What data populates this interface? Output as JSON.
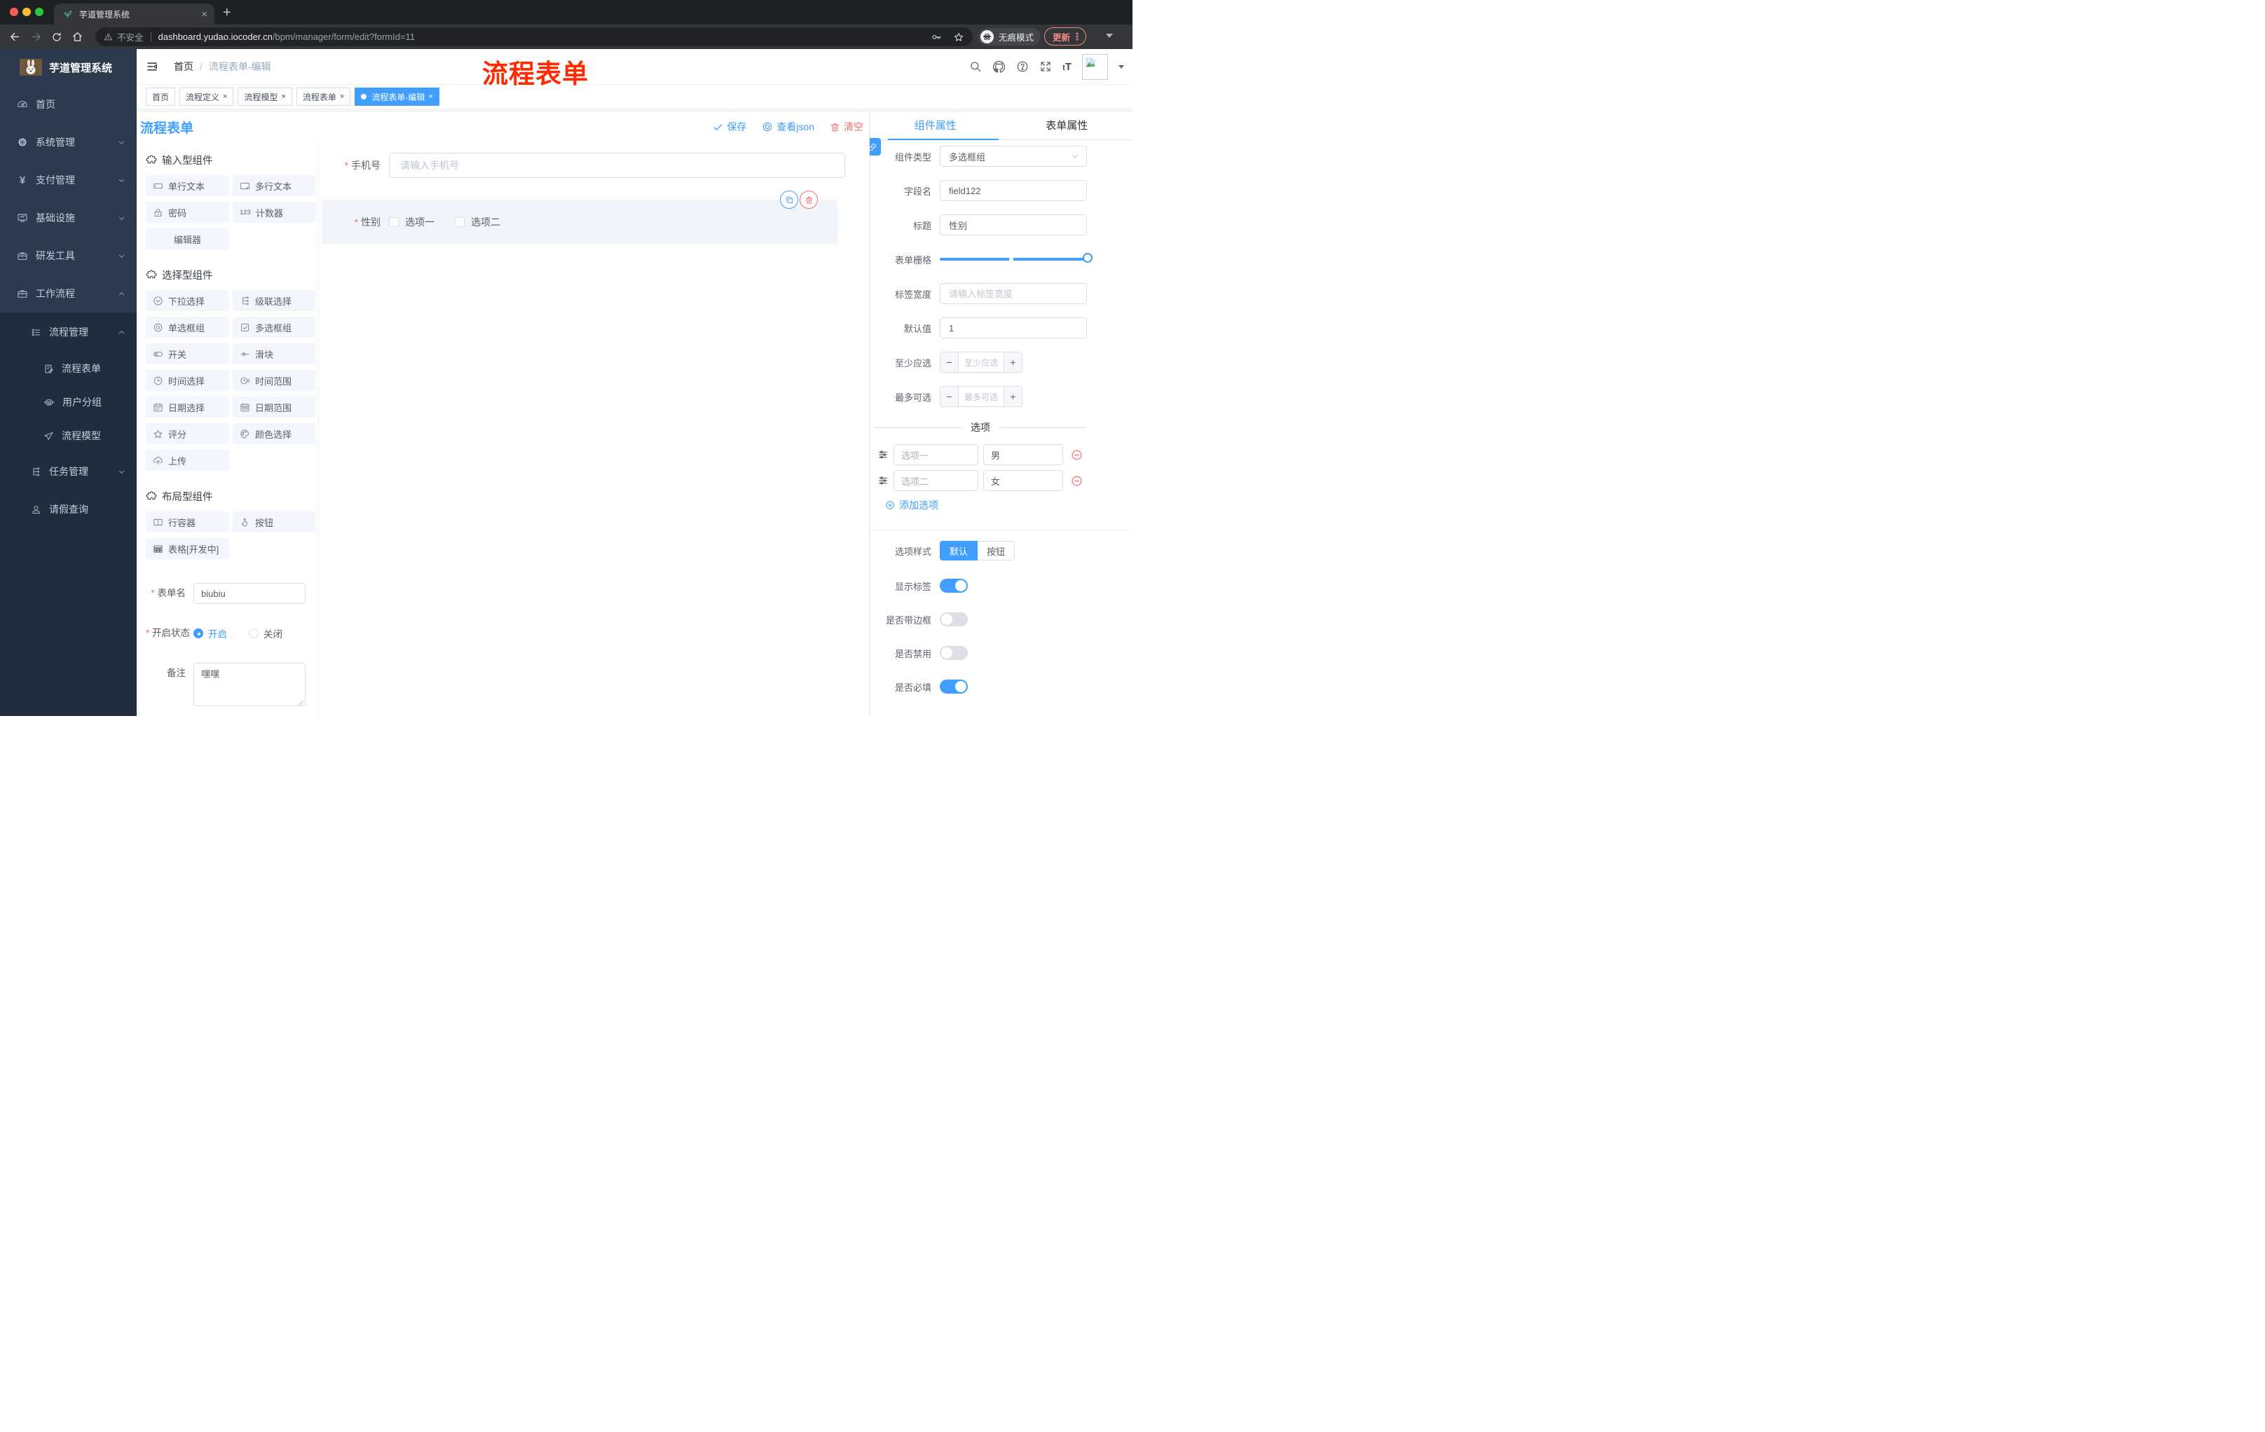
{
  "browser": {
    "tab_title": "芋道管理系统",
    "new_tab": "+",
    "close_tab": "×",
    "security_label": "不安全",
    "url_host": "dashboard.yudao.iocoder.cn",
    "url_path": "/bpm/manager/form/edit?formId=11",
    "incognito_label": "无痕模式",
    "update_label": "更新"
  },
  "sidebar": {
    "app_title": "芋道管理系统",
    "items": [
      {
        "label": "首页",
        "icon": "dashboard-icon",
        "expandable": false
      },
      {
        "label": "系统管理",
        "icon": "gear-icon",
        "expandable": true
      },
      {
        "label": "支付管理",
        "icon": "yen-icon",
        "expandable": true
      },
      {
        "label": "基础设施",
        "icon": "monitor-icon",
        "expandable": true
      },
      {
        "label": "研发工具",
        "icon": "toolbox-icon",
        "expandable": true
      },
      {
        "label": "工作流程",
        "icon": "briefcase-icon",
        "expandable": true,
        "expanded": true
      }
    ],
    "submenu": {
      "parent": {
        "label": "流程管理",
        "icon": "list-icon",
        "expanded": true
      },
      "children": [
        {
          "label": "流程表单",
          "icon": "document-edit-icon"
        },
        {
          "label": "用户分组",
          "icon": "robot-icon"
        },
        {
          "label": "流程模型",
          "icon": "paper-plane-icon"
        }
      ],
      "siblings": [
        {
          "label": "任务管理",
          "icon": "tree-icon",
          "expandable": true
        },
        {
          "label": "请假查询",
          "icon": "user-icon"
        }
      ]
    }
  },
  "breadcrumb": {
    "home": "首页",
    "separator": "/",
    "current": "流程表单-编辑"
  },
  "annotation": {
    "text": "流程表单",
    "color": "#ff2a00"
  },
  "tagbar": {
    "tags": [
      {
        "label": "首页",
        "closable": false,
        "active": false
      },
      {
        "label": "流程定义",
        "closable": true,
        "active": false
      },
      {
        "label": "流程模型",
        "closable": true,
        "active": false
      },
      {
        "label": "流程表单",
        "closable": true,
        "active": false
      },
      {
        "label": "流程表单-编辑",
        "closable": true,
        "active": true
      }
    ],
    "close_glyph": "×"
  },
  "work": {
    "title": "流程表单",
    "save": "保存",
    "view_json": "查看json",
    "clear": "清空"
  },
  "palette": {
    "sections": [
      {
        "title": "输入型组件"
      },
      {
        "title": "选择型组件"
      },
      {
        "title": "布局型组件"
      }
    ],
    "items1": [
      {
        "label": "单行文本",
        "icon": "text-input-icon"
      },
      {
        "label": "多行文本",
        "icon": "textarea-icon"
      },
      {
        "label": "密码",
        "icon": "lock-icon"
      },
      {
        "label": "计数器",
        "icon": "counter-123-icon"
      },
      {
        "label": "编辑器",
        "icon": null
      }
    ],
    "items2": [
      {
        "label": "下拉选择",
        "icon": "select-icon"
      },
      {
        "label": "级联选择",
        "icon": "cascade-icon"
      },
      {
        "label": "单选框组",
        "icon": "radio-icon"
      },
      {
        "label": "多选框组",
        "icon": "checkbox-icon"
      },
      {
        "label": "开关",
        "icon": "switch-icon"
      },
      {
        "label": "滑块",
        "icon": "slider-icon"
      },
      {
        "label": "时间选择",
        "icon": "clock-icon"
      },
      {
        "label": "时间范围",
        "icon": "clock-range-icon"
      },
      {
        "label": "日期选择",
        "icon": "calendar-icon"
      },
      {
        "label": "日期范围",
        "icon": "calendar-range-icon"
      },
      {
        "label": "评分",
        "icon": "star-icon"
      },
      {
        "label": "颜色选择",
        "icon": "palette-icon"
      },
      {
        "label": "上传",
        "icon": "upload-icon"
      }
    ],
    "items3": [
      {
        "label": "行容器",
        "icon": "row-container-icon"
      },
      {
        "label": "按钮",
        "icon": "hand-pointer-icon"
      },
      {
        "label": "表格[开发中]",
        "icon": "table-icon"
      }
    ]
  },
  "meta_form": {
    "name_label": "表单名",
    "name_value": "biubiu",
    "status_label": "开启状态",
    "status_on": "开启",
    "status_off": "关闭",
    "status_selected": "开启",
    "remark_label": "备注",
    "remark_value": "嘿嘿"
  },
  "canvas": {
    "phone_label": "手机号",
    "phone_placeholder": "请输入手机号",
    "phone_required": true,
    "gender_label": "性别",
    "gender_required": true,
    "gender_option1": "选项一",
    "gender_option2": "选项二"
  },
  "panel": {
    "tab_component": "组件属性",
    "tab_form": "表单属性",
    "active_tab": "组件属性",
    "component_type_label": "组件类型",
    "component_type_value": "多选框组",
    "field_name_label": "字段名",
    "field_name_value": "field122",
    "title_label": "标题",
    "title_value": "性别",
    "grid_label": "表单栅格",
    "grid_value_pct": 100,
    "grid_stop_pct": 47,
    "label_width_label": "标签宽度",
    "label_width_placeholder": "请输入标签宽度",
    "default_label": "默认值",
    "default_value": "1",
    "min_label": "至少应选",
    "min_placeholder": "至少应选",
    "min_minus": "−",
    "min_plus": "+",
    "max_label": "最多可选",
    "max_placeholder": "最多可选",
    "max_minus": "−",
    "max_plus": "+",
    "options_title": "选项",
    "options": [
      {
        "label": "选项一",
        "value": "男"
      },
      {
        "label": "选项二",
        "value": "女"
      }
    ],
    "add_option": "添加选项",
    "style_label": "选项样式",
    "style_default": "默认",
    "style_button": "按钮",
    "style_selected": "默认",
    "show_label": "显示标签",
    "show_on": true,
    "border_label": "是否带边框",
    "border_on": false,
    "disabled_label": "是否禁用",
    "disabled_on": false,
    "required_label": "是否必填",
    "required_on": true
  },
  "colors": {
    "accent": "#409eff",
    "danger": "#f56c6c",
    "annotation_red": "#ff2a00",
    "sidebar_bg": "#2d3a4d",
    "sidebar_submenu_bg": "#1f2d3d",
    "palette_card_bg": "#f4f6fe",
    "selected_panel_bg": "#f1f4fb",
    "active_tag_bg": "#409eff"
  }
}
